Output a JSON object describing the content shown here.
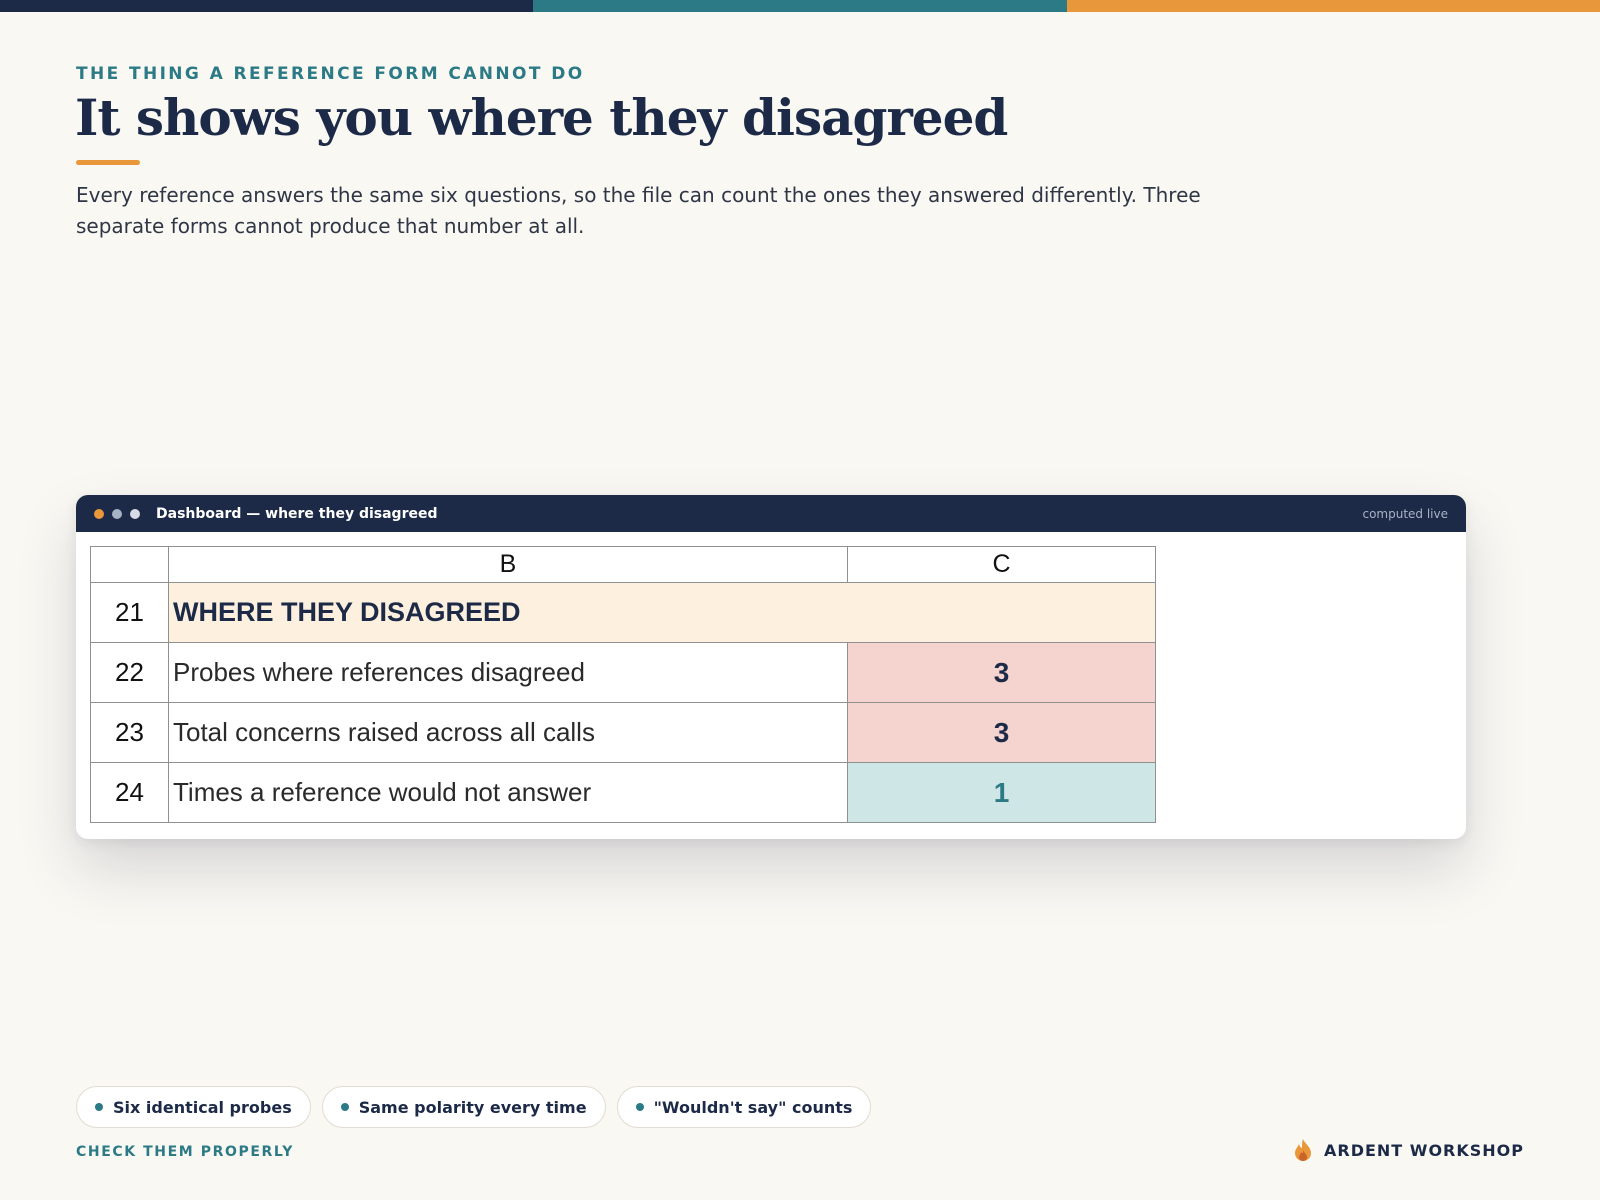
{
  "colors": {
    "navy": "#1c2a47",
    "teal": "#2b7a85",
    "orange": "#e8973a",
    "background": "#faf8f3",
    "section_fill": "#fdf0de",
    "alert_fill": "#f5d4cf",
    "info_fill": "#cfe6e6"
  },
  "header": {
    "eyebrow": "THE THING A REFERENCE FORM CANNOT DO",
    "title": "It shows you where they disagreed",
    "lede": "Every reference answers the same six questions, so the file can count the ones they answered differently. Three separate forms cannot produce that number at all."
  },
  "window": {
    "title": "Dashboard — where they disagreed",
    "status": "computed live",
    "dot_colors": [
      "#e8973a",
      "#a8b2c5",
      "#d7dce5"
    ]
  },
  "sheet": {
    "columns": [
      "",
      "B",
      "C"
    ],
    "section": {
      "row": "21",
      "label": "WHERE THEY DISAGREED"
    },
    "rows": [
      {
        "row": "22",
        "label": "Probes where references disagreed",
        "value": "3",
        "fill": "#f5d4cf",
        "color": "#1c2a47"
      },
      {
        "row": "23",
        "label": "Total concerns raised across all calls",
        "value": "3",
        "fill": "#f5d4cf",
        "color": "#1c2a47"
      },
      {
        "row": "24",
        "label": "Times a reference would not answer",
        "value": "1",
        "fill": "#cfe6e6",
        "color": "#2b7a85"
      }
    ]
  },
  "chips": [
    "Six identical probes",
    "Same polarity every time",
    "\"Wouldn't say\" counts"
  ],
  "footer": {
    "link": "CHECK THEM PROPERLY",
    "brand_name": "ARDENT WORKSHOP",
    "brand_icon": "flame-icon"
  }
}
